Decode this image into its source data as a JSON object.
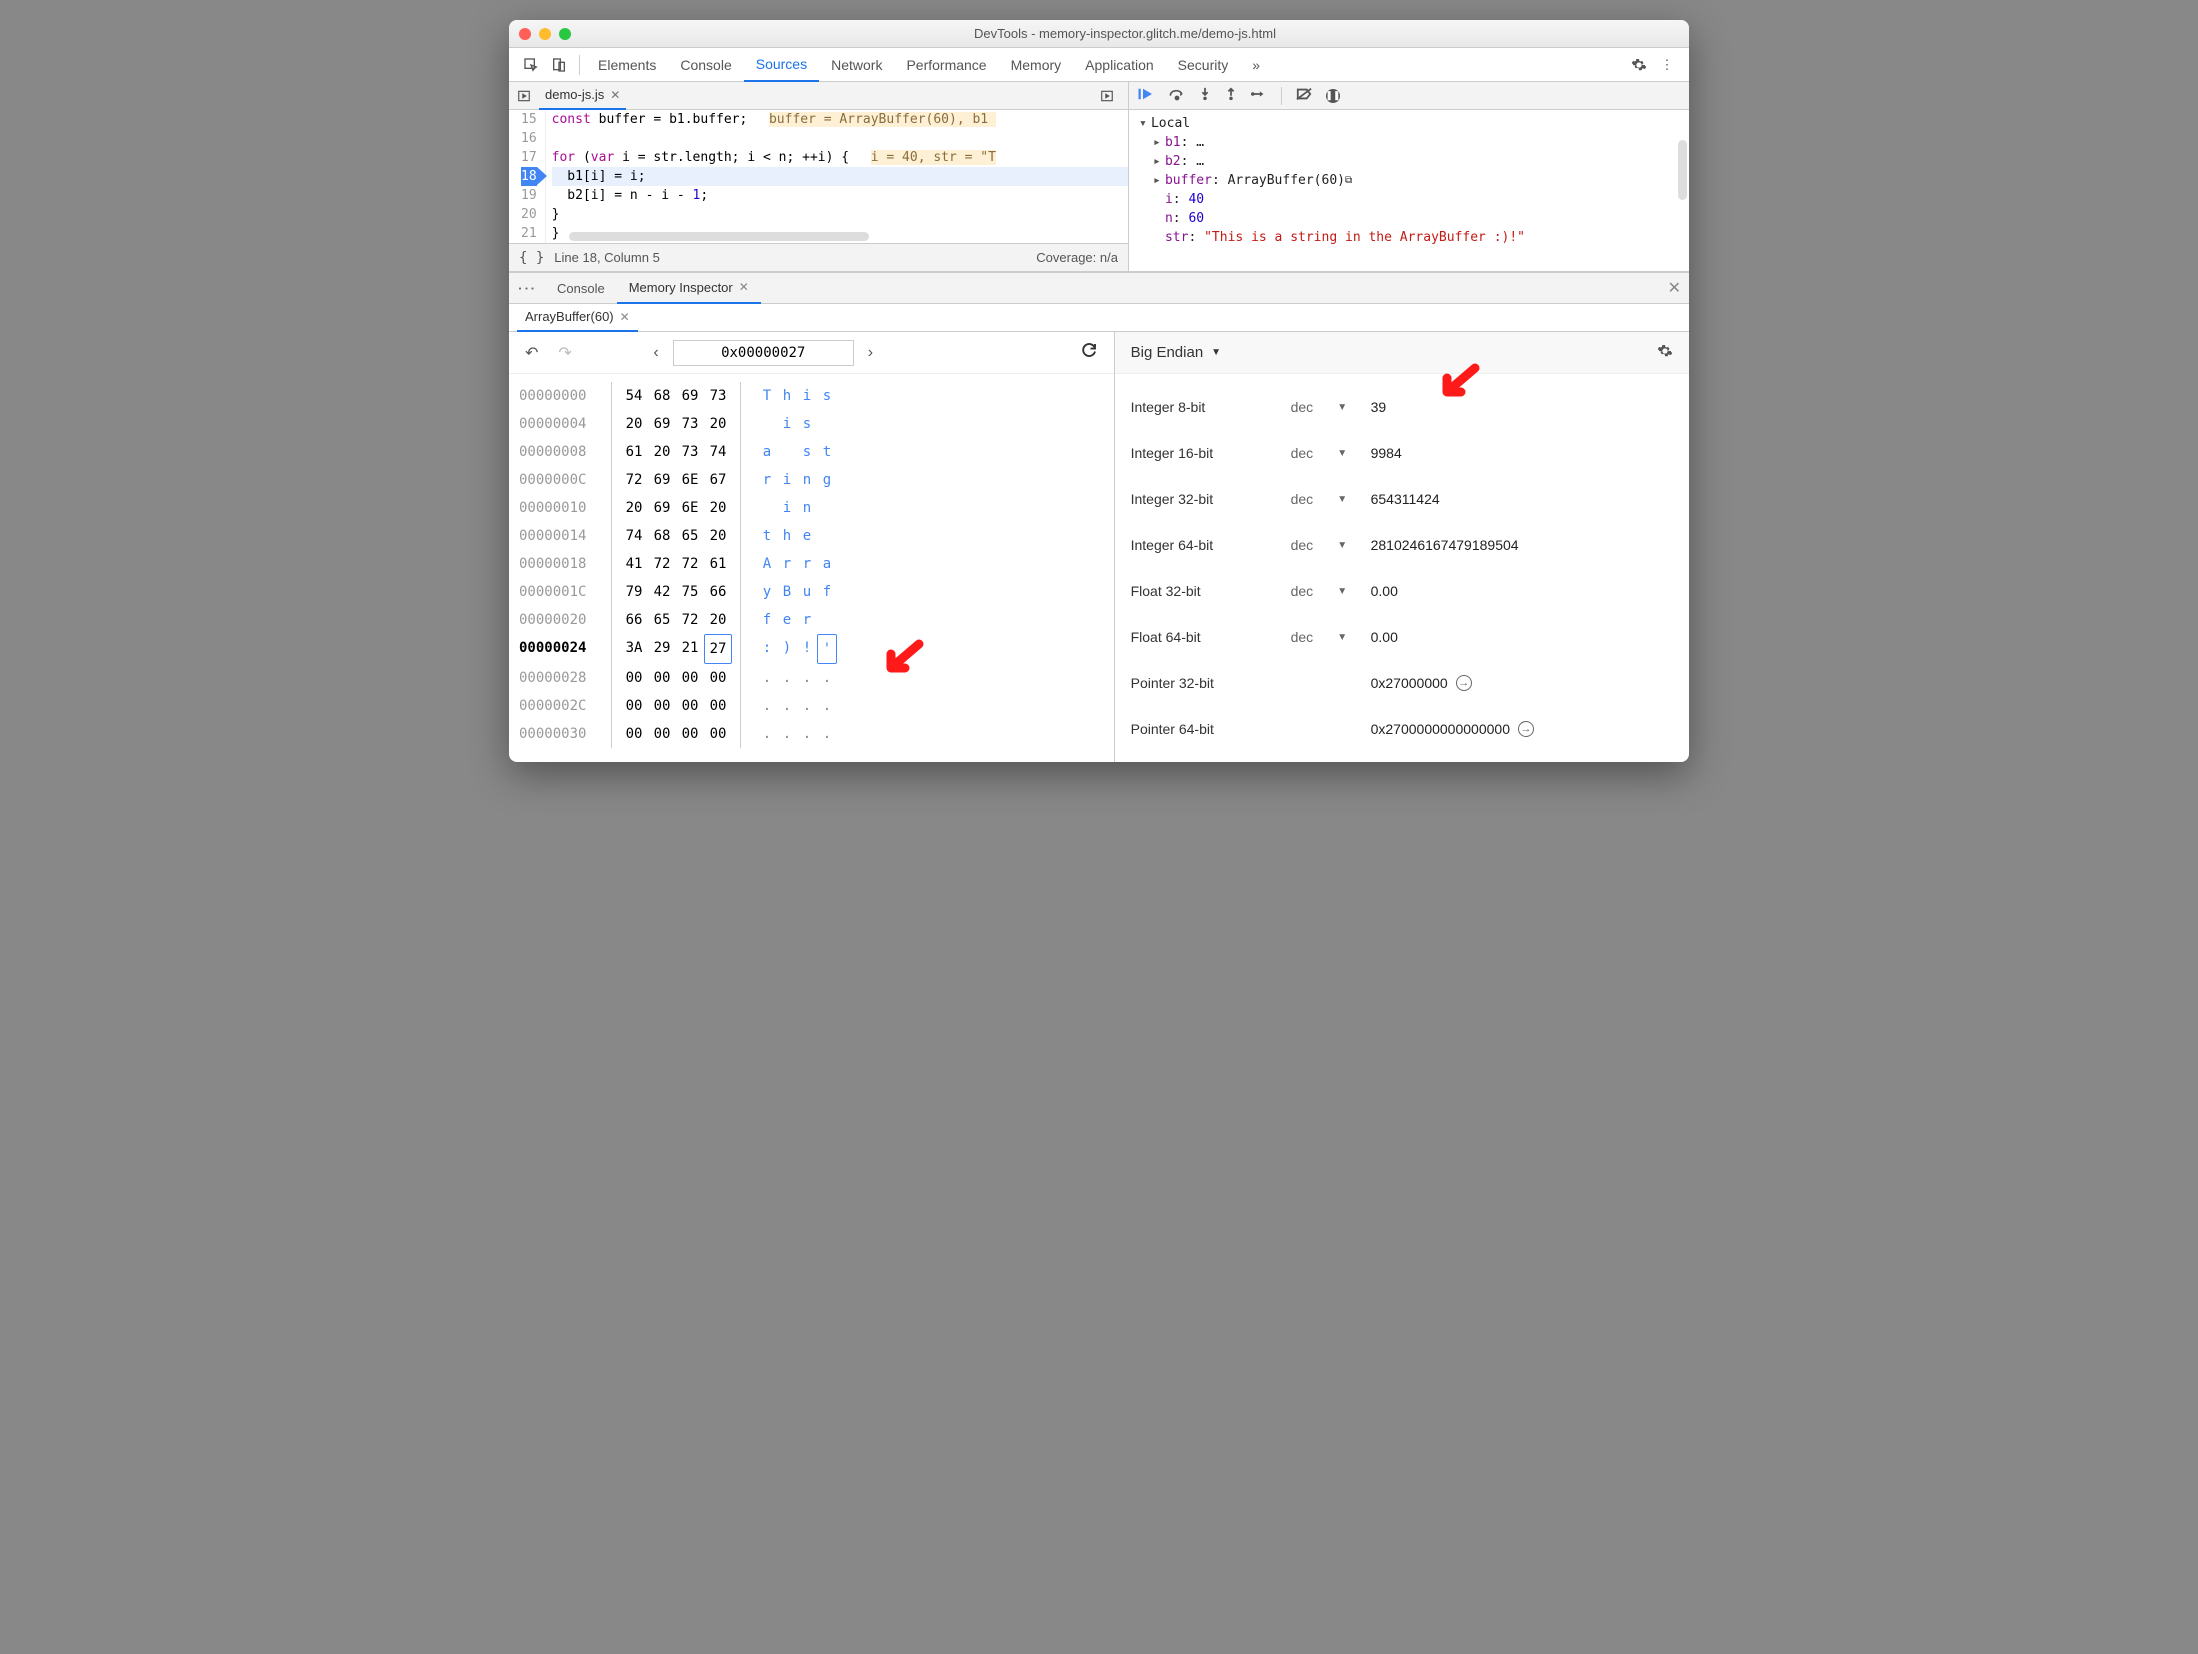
{
  "window": {
    "title": "DevTools - memory-inspector.glitch.me/demo-js.html"
  },
  "tabs": {
    "items": [
      "Elements",
      "Console",
      "Sources",
      "Network",
      "Performance",
      "Memory",
      "Application",
      "Security"
    ],
    "active": "Sources",
    "more": "»"
  },
  "file_tab": {
    "name": "demo-js.js"
  },
  "code": {
    "lines": [
      {
        "n": "15",
        "html": "<span class='kw'>const</span> buffer = b1.buffer;  <span class='inline-var'>buffer = ArrayBuffer(60), b1 </span>"
      },
      {
        "n": "16",
        "html": ""
      },
      {
        "n": "17",
        "html": "<span class='kw'>for</span> (<span class='kw'>var</span> i = str.length; i &lt; n; ++i) {  <span class='inline-var'>i = 40, str = \"T</span>"
      },
      {
        "n": "18",
        "html": "  b1[i] = i;",
        "exec": true
      },
      {
        "n": "19",
        "html": "  b2[i] = n - i - <span class='num'>1</span>;"
      },
      {
        "n": "20",
        "html": "}"
      },
      {
        "n": "21",
        "html": "}"
      }
    ],
    "cursor": "Line 18, Column 5",
    "coverage": "Coverage: n/a"
  },
  "scope": {
    "header": "Local",
    "rows": [
      {
        "caret": "▸",
        "key": "b1",
        "sep": ": ",
        "val": "…",
        "cls": "obj"
      },
      {
        "caret": "▸",
        "key": "b2",
        "sep": ": ",
        "val": "…",
        "cls": "obj"
      },
      {
        "caret": "▸",
        "key": "buffer",
        "sep": ": ",
        "val": "ArrayBuffer(60)",
        "cls": "obj",
        "reveal": true
      },
      {
        "caret": " ",
        "key": "i",
        "sep": ": ",
        "val": "40",
        "cls": "val"
      },
      {
        "caret": " ",
        "key": "n",
        "sep": ": ",
        "val": "60",
        "cls": "val"
      },
      {
        "caret": " ",
        "key": "str",
        "sep": ": ",
        "val": "\"This is a string in the ArrayBuffer :)!\"",
        "cls": "vstr"
      }
    ]
  },
  "drawer": {
    "tabs": [
      "Console",
      "Memory Inspector"
    ],
    "active": "Memory Inspector"
  },
  "mi": {
    "buffer_tab": "ArrayBuffer(60)",
    "address": "0x00000027",
    "endian": "Big Endian",
    "rows": [
      {
        "addr": "00000000",
        "b": [
          "54",
          "68",
          "69",
          "73"
        ],
        "a": [
          "T",
          "h",
          "i",
          "s"
        ]
      },
      {
        "addr": "00000004",
        "b": [
          "20",
          "69",
          "73",
          "20"
        ],
        "a": [
          " ",
          "i",
          "s",
          " "
        ]
      },
      {
        "addr": "00000008",
        "b": [
          "61",
          "20",
          "73",
          "74"
        ],
        "a": [
          "a",
          " ",
          "s",
          "t"
        ]
      },
      {
        "addr": "0000000C",
        "b": [
          "72",
          "69",
          "6E",
          "67"
        ],
        "a": [
          "r",
          "i",
          "n",
          "g"
        ]
      },
      {
        "addr": "00000010",
        "b": [
          "20",
          "69",
          "6E",
          "20"
        ],
        "a": [
          " ",
          "i",
          "n",
          " "
        ]
      },
      {
        "addr": "00000014",
        "b": [
          "74",
          "68",
          "65",
          "20"
        ],
        "a": [
          "t",
          "h",
          "e",
          " "
        ]
      },
      {
        "addr": "00000018",
        "b": [
          "41",
          "72",
          "72",
          "61"
        ],
        "a": [
          "A",
          "r",
          "r",
          "a"
        ]
      },
      {
        "addr": "0000001C",
        "b": [
          "79",
          "42",
          "75",
          "66"
        ],
        "a": [
          "y",
          "B",
          "u",
          "f"
        ]
      },
      {
        "addr": "00000020",
        "b": [
          "66",
          "65",
          "72",
          "20"
        ],
        "a": [
          "f",
          "e",
          "r",
          " "
        ]
      },
      {
        "addr": "00000024",
        "b": [
          "3A",
          "29",
          "21",
          "27"
        ],
        "a": [
          ":",
          ")",
          "!",
          "'"
        ],
        "cur": true,
        "sel": 3
      },
      {
        "addr": "00000028",
        "b": [
          "00",
          "00",
          "00",
          "00"
        ],
        "a": [
          ".",
          ".",
          ".",
          "."
        ],
        "dim": true
      },
      {
        "addr": "0000002C",
        "b": [
          "00",
          "00",
          "00",
          "00"
        ],
        "a": [
          ".",
          ".",
          ".",
          "."
        ],
        "dim": true
      },
      {
        "addr": "00000030",
        "b": [
          "00",
          "00",
          "00",
          "00"
        ],
        "a": [
          ".",
          ".",
          ".",
          "."
        ],
        "dim": true
      }
    ],
    "values": [
      {
        "label": "Integer 8-bit",
        "base": "dec",
        "value": "39"
      },
      {
        "label": "Integer 16-bit",
        "base": "dec",
        "value": "9984"
      },
      {
        "label": "Integer 32-bit",
        "base": "dec",
        "value": "654311424"
      },
      {
        "label": "Integer 64-bit",
        "base": "dec",
        "value": "2810246167479189504"
      },
      {
        "label": "Float 32-bit",
        "base": "dec",
        "value": "0.00"
      },
      {
        "label": "Float 64-bit",
        "base": "dec",
        "value": "0.00"
      },
      {
        "label": "Pointer 32-bit",
        "base": "",
        "value": "0x27000000",
        "goto": true
      },
      {
        "label": "Pointer 64-bit",
        "base": "",
        "value": "0x2700000000000000",
        "goto": true
      }
    ]
  }
}
